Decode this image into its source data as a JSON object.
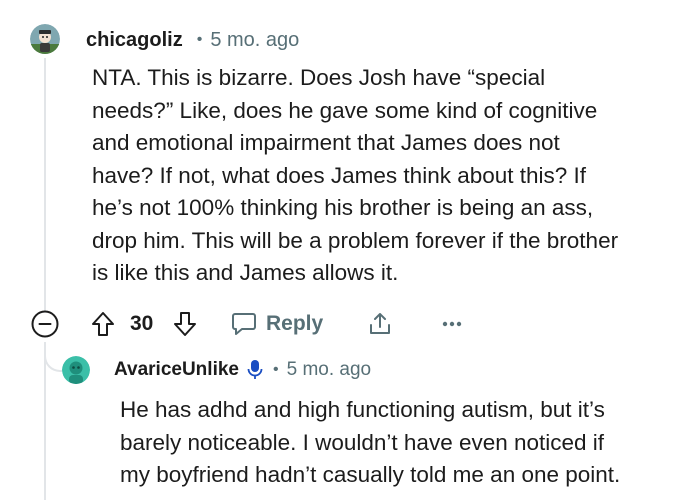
{
  "comment": {
    "username": "chicagoliz",
    "separator": "•",
    "age": "5 mo. ago",
    "lines": [
      "NTA. This is bizarre. Does Josh have “special",
      "needs?” Like, does he gave some kind of cognitive",
      "and emotional impairment that James does not",
      "have? If not, what does James think about this? If",
      "he’s not 100% thinking his brother is being an ass,",
      "drop him. This will be a problem forever if the brother",
      "is like this and James allows it."
    ],
    "avatar_icon": "snoo-avatar-icon"
  },
  "actions": {
    "collapse_icon": "minus-circle-icon",
    "upvote_icon": "arrow-up-icon",
    "vote_count": "30",
    "downvote_icon": "arrow-down-icon",
    "reply_icon": "speech-bubble-icon",
    "reply_label": "Reply",
    "share_icon": "share-icon",
    "more_icon": "ellipsis-icon",
    "more_label": "•••"
  },
  "reply": {
    "username": "AvariceUnlike",
    "separator": "•",
    "age": "5 mo. ago",
    "lines": [
      "He has adhd and high functioning autism, but it’s",
      "barely noticeable. I wouldn’t have even noticed if",
      "my boyfriend hadn’t casually told me an one point."
    ],
    "avatar_icon": "snoo-avatar-icon",
    "badge_icon": "microphone-icon"
  },
  "colors": {
    "text": "#1c1c1c",
    "meta": "#576f76",
    "thread_line": "#e2e5e8",
    "reply_avatar": "#3bbfa8",
    "mic_badge": "#1a4ec2"
  }
}
